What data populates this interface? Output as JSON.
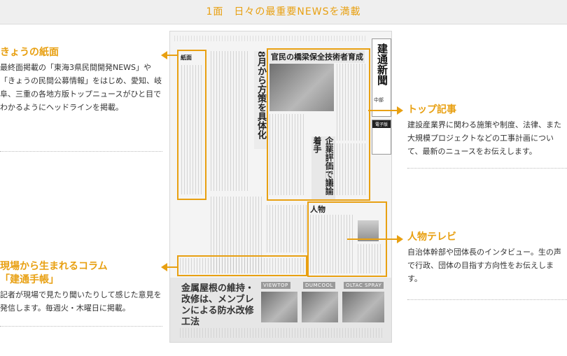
{
  "header": {
    "title": "1面　日々の最重要NEWSを満載"
  },
  "sections": {
    "kyou": {
      "title": "きょうの紙面",
      "body": "最終面掲載の「東海3県民間開発NEWS」や「きょうの民間公募情報」をはじめ、愛知、岐阜、三重の各地方版トップニュースがひと目でわかるようにヘッドラインを掲載。"
    },
    "top": {
      "title": "トップ記事",
      "body": "建設産業界に関わる施策や制度、法律、また大規模プロジェクトなどの工事計画について、最新のニュースをお伝えします。"
    },
    "genba": {
      "title": "現場から生まれるコラム",
      "title2": "「建通手帳」",
      "body": "記者が現場で見たり聞いたりして感じた意見を発信します。毎週火・木曜日に掲載。"
    },
    "jinbutsu": {
      "title": "人物テレビ",
      "body": "自治体幹部や団体長のインタビュー。生の声で行政、団体の目指す方向性をお伝えします。"
    }
  },
  "newspaper": {
    "masthead": "建通新聞",
    "edition": "中部",
    "digital": "電子版",
    "headline_top": "官民の橋梁保全技術者育成",
    "headline_left": "8月から方策を具体化",
    "headline_mid": "企業評価で議論着手",
    "kyou_label": "紙面",
    "jinbutsu_label": "人物",
    "ad_headline": "金属屋根の維持・改修は、メンブレンによる防水改修工法",
    "ad_products": [
      "VIEWTOP",
      "DUMCOOL",
      "OLTAC SPRAY"
    ]
  }
}
